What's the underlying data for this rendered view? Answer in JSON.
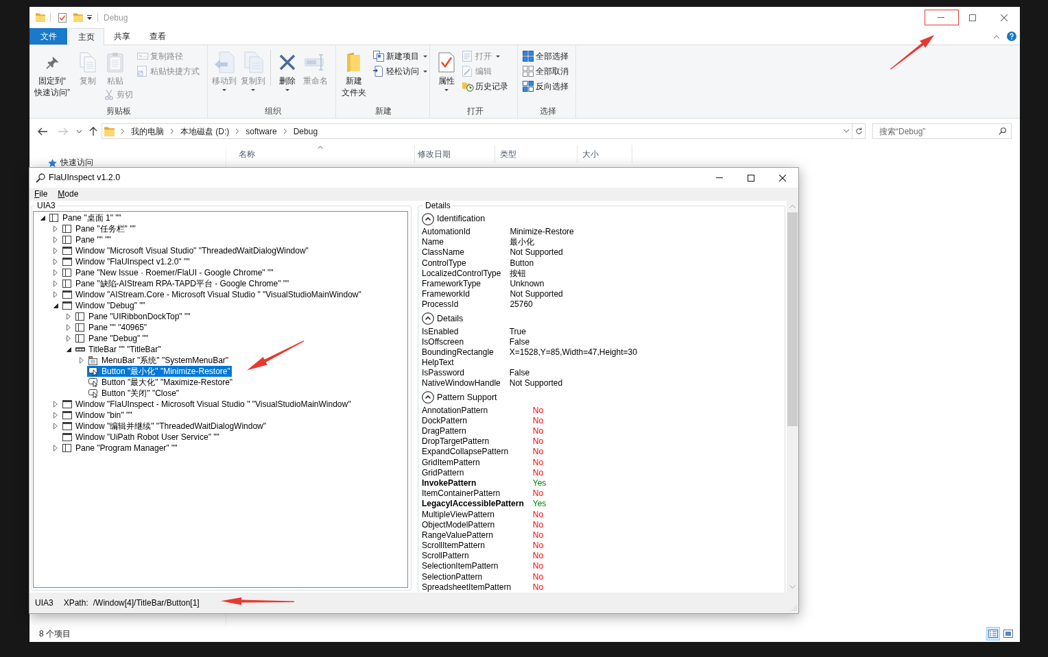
{
  "explorer": {
    "title": "Debug",
    "ribbon_tabs": [
      {
        "label": "文件",
        "kind": "file",
        "selected": false
      },
      {
        "label": "主页",
        "kind": "tab",
        "selected": true
      },
      {
        "label": "共享",
        "kind": "tab",
        "selected": false
      },
      {
        "label": "查看",
        "kind": "tab",
        "selected": false
      }
    ],
    "ribbon_groups": [
      {
        "label": "剪贴板",
        "columns": [
          {
            "buttons": [
              {
                "label": "固定到“快速访问”",
                "kind": "large",
                "disabled": false,
                "dropdown": false
              }
            ]
          },
          {
            "buttons": [
              {
                "label": "复制",
                "kind": "large",
                "disabled": true,
                "dropdown": false
              }
            ]
          },
          {
            "buttons": [
              {
                "label": "粘贴",
                "kind": "large",
                "disabled": true,
                "dropdown": false
              },
              {
                "label": "剪切",
                "kind": "small",
                "disabled": true,
                "dropdown": false
              }
            ]
          },
          {
            "buttons": [
              {
                "label": "复制路径",
                "kind": "small",
                "disabled": true,
                "dropdown": false
              },
              {
                "label": "粘贴快捷方式",
                "kind": "small",
                "disabled": true,
                "dropdown": false
              }
            ]
          }
        ]
      },
      {
        "label": "组织",
        "columns": [
          {
            "buttons": [
              {
                "label": "移动到",
                "kind": "large",
                "disabled": true,
                "dropdown": true
              }
            ]
          },
          {
            "buttons": [
              {
                "label": "复制到",
                "kind": "large",
                "disabled": true,
                "dropdown": true
              }
            ]
          },
          {
            "separated": true,
            "buttons": [
              {
                "label": "删除",
                "kind": "large",
                "disabled": false,
                "dropdown": true
              }
            ]
          },
          {
            "buttons": [
              {
                "label": "重命名",
                "kind": "large",
                "disabled": true,
                "dropdown": false
              }
            ]
          }
        ]
      },
      {
        "label": "新建",
        "columns": [
          {
            "buttons": [
              {
                "label": "新建文件夹",
                "kind": "large",
                "disabled": false,
                "dropdown": false
              }
            ]
          },
          {
            "buttons": [
              {
                "label": "新建项目",
                "kind": "small",
                "disabled": false,
                "dropdown": true
              },
              {
                "label": "轻松访问",
                "kind": "small",
                "disabled": false,
                "dropdown": true
              }
            ]
          }
        ]
      },
      {
        "label": "打开",
        "columns": [
          {
            "buttons": [
              {
                "label": "属性",
                "kind": "large",
                "disabled": false,
                "dropdown": true
              }
            ]
          },
          {
            "buttons": [
              {
                "label": "打开",
                "kind": "small",
                "disabled": true,
                "dropdown": true
              },
              {
                "label": "编辑",
                "kind": "small",
                "disabled": true,
                "dropdown": false
              },
              {
                "label": "历史记录",
                "kind": "small",
                "disabled": false,
                "dropdown": false
              }
            ]
          }
        ]
      },
      {
        "label": "选择",
        "columns": [
          {
            "buttons": [
              {
                "label": "全部选择",
                "kind": "small",
                "disabled": false,
                "dropdown": false
              },
              {
                "label": "全部取消",
                "kind": "small",
                "disabled": false,
                "dropdown": false
              },
              {
                "label": "反向选择",
                "kind": "small",
                "disabled": false,
                "dropdown": false
              }
            ]
          }
        ]
      }
    ],
    "nav_buttons": [
      {
        "kind": "back",
        "disabled": false
      },
      {
        "kind": "forward",
        "disabled": true
      },
      {
        "kind": "recent",
        "disabled": false
      },
      {
        "kind": "up",
        "disabled": false
      }
    ],
    "breadcrumbs": [
      "我的电脑",
      "本地磁盘 (D:)",
      "software",
      "Debug"
    ],
    "search": {
      "placeholder": "搜索“Debug”"
    },
    "columns": [
      {
        "label": "名称",
        "sorted": true
      },
      {
        "label": "修改日期",
        "sorted": false
      },
      {
        "label": "类型",
        "sorted": false
      },
      {
        "label": "大小",
        "sorted": false
      }
    ],
    "nav_pane": [
      {
        "label": "快速访问"
      }
    ],
    "status": {
      "item_count": "8 个项目",
      "views": [
        {
          "kind": "details",
          "selected": true
        },
        {
          "kind": "large_icons",
          "selected": false
        }
      ]
    }
  },
  "inspector": {
    "title": "FlaUInspect v1.2.0",
    "menu": [
      "File",
      "Mode"
    ],
    "tree_panel": {
      "title": "UIA3",
      "items": [
        {
          "label": "Pane \"桌面 1\" \"\"",
          "kind": "pane",
          "expandable": true,
          "expanded": true,
          "selected": false,
          "children": [
            {
              "label": "Pane \"任务栏\" \"\"",
              "kind": "pane",
              "expandable": true,
              "expanded": false,
              "selected": false
            },
            {
              "label": "Pane \"\" \"\"",
              "kind": "pane",
              "expandable": true,
              "expanded": false,
              "selected": false
            },
            {
              "label": "Window \"Microsoft Visual Studio\" \"ThreadedWaitDialogWindow\"",
              "kind": "window",
              "expandable": true,
              "expanded": false,
              "selected": false
            },
            {
              "label": "Window \"FlaUInspect v1.2.0\" \"\"",
              "kind": "window",
              "expandable": true,
              "expanded": false,
              "selected": false
            },
            {
              "label": "Pane \"New Issue · Roemer/FlaUI - Google Chrome\" \"\"",
              "kind": "pane",
              "expandable": true,
              "expanded": false,
              "selected": false
            },
            {
              "label": "Pane \"缺陷-AIStream RPA-TAPD平台 - Google Chrome\" \"\"",
              "kind": "pane",
              "expandable": true,
              "expanded": false,
              "selected": false
            },
            {
              "label": "Window \"AIStream.Core - Microsoft Visual Studio \" \"VisualStudioMainWindow\"",
              "kind": "window",
              "expandable": true,
              "expanded": false,
              "selected": false
            },
            {
              "label": "Window \"Debug\" \"\"",
              "kind": "window",
              "expandable": true,
              "expanded": true,
              "selected": false,
              "children": [
                {
                  "label": "Pane \"UIRibbonDockTop\" \"\"",
                  "kind": "pane",
                  "expandable": true,
                  "expanded": false,
                  "selected": false
                },
                {
                  "label": "Pane \"\" \"40965\"",
                  "kind": "pane",
                  "expandable": true,
                  "expanded": false,
                  "selected": false
                },
                {
                  "label": "Pane \"Debug\" \"\"",
                  "kind": "pane",
                  "expandable": true,
                  "expanded": false,
                  "selected": false
                },
                {
                  "label": "TitleBar \"\" \"TitleBar\"",
                  "kind": "titlebar",
                  "expandable": true,
                  "expanded": true,
                  "selected": false,
                  "children": [
                    {
                      "label": "MenuBar \"系统\" \"SystemMenuBar\"",
                      "kind": "menubar",
                      "expandable": true,
                      "expanded": false,
                      "selected": false
                    },
                    {
                      "label": "Button \"最小化\" \"Minimize-Restore\"",
                      "kind": "button",
                      "expandable": false,
                      "selected": true
                    },
                    {
                      "label": "Button \"最大化\" \"Maximize-Restore\"",
                      "kind": "button",
                      "expandable": false,
                      "selected": false
                    },
                    {
                      "label": "Button \"关闭\" \"Close\"",
                      "kind": "button",
                      "expandable": false,
                      "selected": false
                    }
                  ]
                }
              ]
            },
            {
              "label": "Window \"FlaUInspect - Microsoft Visual Studio \" \"VisualStudioMainWindow\"",
              "kind": "window",
              "expandable": true,
              "expanded": false,
              "selected": false
            },
            {
              "label": "Window \"bin\" \"\"",
              "kind": "window",
              "expandable": true,
              "expanded": false,
              "selected": false
            },
            {
              "label": "Window \"编辑并继续\" \"ThreadedWaitDialogWindow\"",
              "kind": "window",
              "expandable": true,
              "expanded": false,
              "selected": false
            },
            {
              "label": "Window \"UiPath Robot User Service\" \"\"",
              "kind": "window",
              "expandable": false,
              "selected": false
            },
            {
              "label": "Pane \"Program Manager\" \"\"",
              "kind": "pane",
              "expandable": true,
              "expanded": false,
              "selected": false
            }
          ]
        }
      ]
    },
    "details_panel": {
      "title": "Details",
      "sections": [
        {
          "title": "Identification",
          "kind": "properties",
          "expanded": true,
          "rows": [
            {
              "name": "AutomationId",
              "value": "Minimize-Restore"
            },
            {
              "name": "Name",
              "value": "最小化"
            },
            {
              "name": "ClassName",
              "value": "Not Supported"
            },
            {
              "name": "ControlType",
              "value": "Button"
            },
            {
              "name": "LocalizedControlType",
              "value": "按钮"
            },
            {
              "name": "FrameworkType",
              "value": "Unknown"
            },
            {
              "name": "FrameworkId",
              "value": "Not Supported"
            },
            {
              "name": "ProcessId",
              "value": "25760"
            }
          ]
        },
        {
          "title": "Details",
          "kind": "properties",
          "expanded": true,
          "rows": [
            {
              "name": "IsEnabled",
              "value": "True"
            },
            {
              "name": "IsOffscreen",
              "value": "False"
            },
            {
              "name": "BoundingRectangle",
              "value": "X=1528,Y=85,Width=47,Height=30"
            },
            {
              "name": "HelpText"
            },
            {
              "name": "IsPassword",
              "value": "False"
            },
            {
              "name": "NativeWindowHandle",
              "value": "Not Supported"
            }
          ]
        },
        {
          "title": "Pattern Support",
          "kind": "patterns",
          "expanded": true,
          "rows": [
            {
              "name": "AnnotationPattern",
              "value": "No",
              "supported": false
            },
            {
              "name": "DockPattern",
              "value": "No",
              "supported": false
            },
            {
              "name": "DragPattern",
              "value": "No",
              "supported": false
            },
            {
              "name": "DropTargetPattern",
              "value": "No",
              "supported": false
            },
            {
              "name": "ExpandCollapsePattern",
              "value": "No",
              "supported": false
            },
            {
              "name": "GridItemPattern",
              "value": "No",
              "supported": false
            },
            {
              "name": "GridPattern",
              "value": "No",
              "supported": false
            },
            {
              "name": "InvokePattern",
              "value": "Yes",
              "supported": true
            },
            {
              "name": "ItemContainerPattern",
              "value": "No",
              "supported": false
            },
            {
              "name": "LegacyIAccessiblePattern",
              "value": "Yes",
              "supported": true
            },
            {
              "name": "MultipleViewPattern",
              "value": "No",
              "supported": false
            },
            {
              "name": "ObjectModelPattern",
              "value": "No",
              "supported": false
            },
            {
              "name": "RangeValuePattern",
              "value": "No",
              "supported": false
            },
            {
              "name": "ScrollItemPattern",
              "value": "No",
              "supported": false
            },
            {
              "name": "ScrollPattern",
              "value": "No",
              "supported": false
            },
            {
              "name": "SelectionItemPattern",
              "value": "No",
              "supported": false
            },
            {
              "name": "SelectionPattern",
              "value": "No",
              "supported": false
            },
            {
              "name": "SpreadsheetItemPattern",
              "value": "No",
              "supported": false
            }
          ]
        }
      ]
    },
    "status_bar": {
      "mode": "UIA3",
      "xpath_label": "XPath:",
      "xpath": "/Window[4]/TitleBar/Button[1]"
    }
  }
}
